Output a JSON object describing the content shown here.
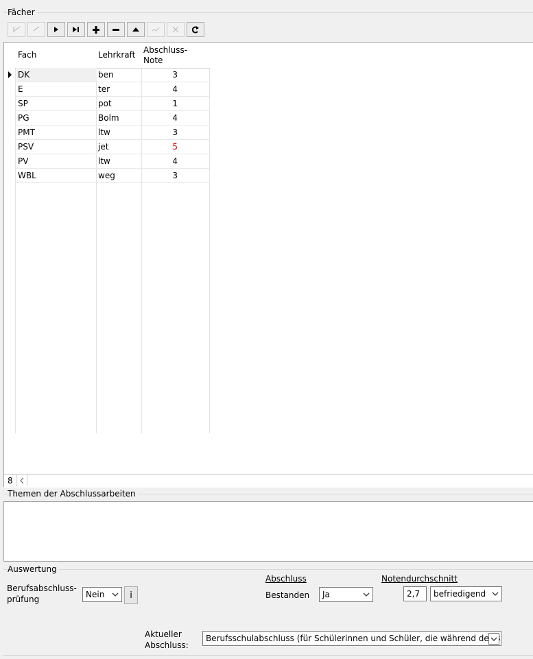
{
  "faecher": {
    "section_label": "Fächer",
    "toolbar": [
      {
        "name": "first-record-button",
        "icon": "first-icon",
        "enabled": false
      },
      {
        "name": "prior-record-button",
        "icon": "prior-icon",
        "enabled": false
      },
      {
        "name": "next-record-button",
        "icon": "next-icon",
        "enabled": true
      },
      {
        "name": "last-record-button",
        "icon": "last-icon",
        "enabled": true
      },
      {
        "name": "insert-record-button",
        "icon": "plus-icon",
        "enabled": true
      },
      {
        "name": "delete-record-button",
        "icon": "minus-icon",
        "enabled": true
      },
      {
        "name": "edit-record-button",
        "icon": "triangle-up-icon",
        "enabled": true
      },
      {
        "name": "post-record-button",
        "icon": "check-icon",
        "enabled": false
      },
      {
        "name": "cancel-record-button",
        "icon": "cross-icon",
        "enabled": false
      },
      {
        "name": "refresh-button",
        "icon": "refresh-icon",
        "enabled": true
      }
    ],
    "columns": [
      "Fach",
      "Lehrkraft",
      "Abschluss-\nNote"
    ],
    "rows": [
      {
        "fach": "DK",
        "lehrkraft": "ben",
        "note": "3"
      },
      {
        "fach": "E",
        "lehrkraft": "ter",
        "note": "4"
      },
      {
        "fach": "SP",
        "lehrkraft": "pot",
        "note": "1"
      },
      {
        "fach": "PG",
        "lehrkraft": "Bolm",
        "note": "4"
      },
      {
        "fach": "PMT",
        "lehrkraft": "ltw",
        "note": "3"
      },
      {
        "fach": "PSV",
        "lehrkraft": "jet",
        "note": "5",
        "highlight": true
      },
      {
        "fach": "PV",
        "lehrkraft": "ltw",
        "note": "4"
      },
      {
        "fach": "WBL",
        "lehrkraft": "weg",
        "note": "3"
      }
    ],
    "record_count": "8",
    "highlight_color": "#e00000"
  },
  "themen": {
    "section_label": "Themen der Abschlussarbeiten",
    "value": ""
  },
  "auswertung": {
    "section_label": "Auswertung",
    "berufsabschluss_label_1": "Berufsabschluss-",
    "berufsabschluss_label_2": "prüfung",
    "berufsabschluss_value": "Nein",
    "info_button_label": "i",
    "abschluss_heading": "Abschluss",
    "bestanden_label": "Bestanden",
    "bestanden_value": "Ja",
    "notendurchschnitt_heading": "Notendurchschnitt",
    "notendurchschnitt_value": "2,7",
    "notendurchschnitt_text": "befriedigend",
    "aktueller_label_1": "Aktueller",
    "aktueller_label_2": "Abschluss:",
    "aktueller_value": "Berufsschulabschluss (für Schülerinnen und Schüler, die während der Be"
  }
}
